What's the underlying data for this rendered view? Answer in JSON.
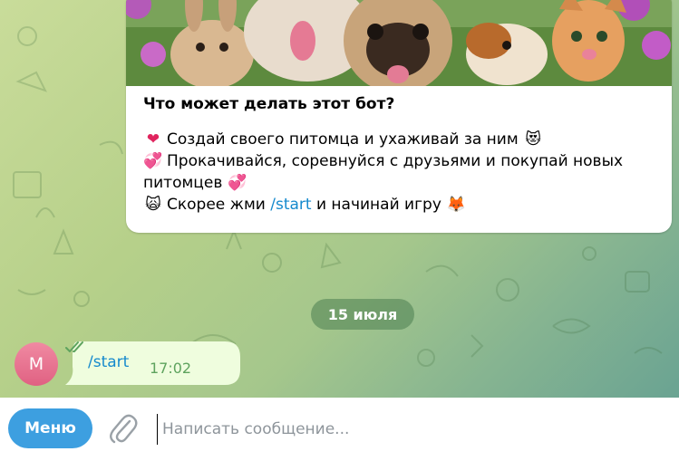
{
  "bot_card": {
    "title": "Что может делать этот бот?",
    "lines": [
      {
        "emoji": "❤",
        "text": "Создай своего питомца и ухаживай за ним",
        "emoji_end": "😻"
      },
      {
        "emoji": "💞",
        "text": "Прокачивайся, соревнуйся с друзьями и покупай новых питомцев",
        "emoji_end": "💞"
      },
      {
        "emoji": "🙀",
        "text_before": "Скорее жми",
        "link": "/start",
        "text_after": "и начинай игру",
        "emoji_end": "🦊"
      }
    ],
    "image_icon": "cute-pets-photo"
  },
  "date_divider": "15 июля",
  "outgoing_message": {
    "avatar_letter": "M",
    "text": "/start",
    "time": "17:02",
    "status_icon": "double-check-icon"
  },
  "composer": {
    "menu_label": "Меню",
    "attach_icon": "paperclip-icon",
    "placeholder": "Написать сообщение..."
  },
  "colors": {
    "accent": "#3d9fe0",
    "link": "#168acd",
    "outgoing_bubble": "#effdde",
    "read_ticks": "#5ea35e"
  }
}
